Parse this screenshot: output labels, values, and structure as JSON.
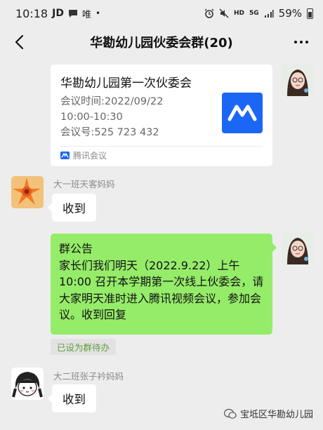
{
  "status_bar": {
    "time": "10:18",
    "carrier": "JD",
    "carrier_extra": "唯",
    "dot": "•",
    "signal_hd": "HD",
    "signal_5g": "5G",
    "battery": "59%"
  },
  "header": {
    "title": "华勘幼儿园伙委会群(20)"
  },
  "messages": {
    "meeting_card": {
      "title": "华勘幼儿园第一次伙委会",
      "time_line": "会议时间:2022/09/22",
      "time_range": "10:00-10:30",
      "meeting_id": "会议号:525 723 432",
      "source": "腾讯会议"
    },
    "reply1": {
      "sender": "大一班天客妈妈",
      "text": "收到"
    },
    "announcement": {
      "heading": "群公告",
      "body": "家长们我们明天（2022.9.22）上午10:00 召开本学期第一次线上伙委会，请大家明天准时进入腾讯视频会议，参加会议。收到回复",
      "tag": "已设为群待办"
    },
    "reply2": {
      "sender": "大二班张子衿妈妈",
      "text": "收到"
    }
  },
  "watermark": {
    "text": "宝坻区华勘幼儿园"
  },
  "colors": {
    "background": "#ededed",
    "self_bubble": "#95ec69",
    "tencent_meeting_blue": "#1b66f5"
  }
}
